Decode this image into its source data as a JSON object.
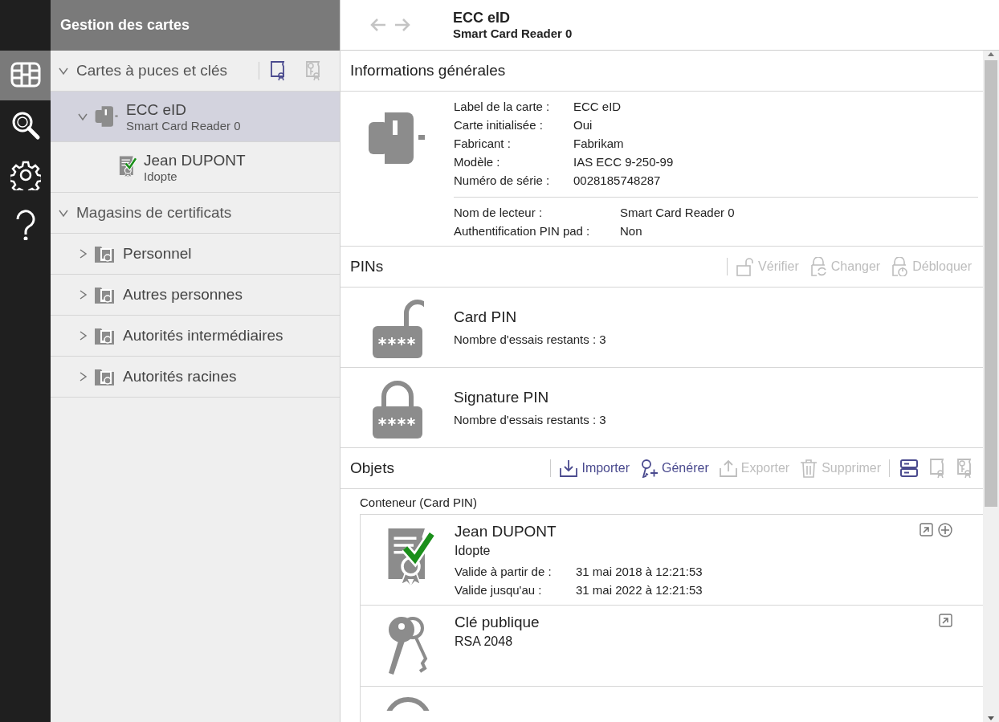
{
  "nav_rail": [
    {
      "kind": "cards",
      "selected": true
    },
    {
      "kind": "search",
      "selected": false
    },
    {
      "kind": "settings",
      "selected": false
    },
    {
      "kind": "help",
      "selected": false
    }
  ],
  "sidebar": {
    "title": "Gestion des cartes",
    "sections": [
      {
        "label": "Cartes à puces et clés",
        "expanded": true,
        "tools": [
          {
            "kind": "certificate",
            "disabled": false
          },
          {
            "kind": "key-certificate",
            "disabled": true
          }
        ],
        "children": [
          {
            "kind": "card",
            "title": "ECC eID",
            "subtitle": "Smart Card Reader 0",
            "selected": true,
            "expanded": true,
            "children": [
              {
                "kind": "certificate",
                "title": "Jean DUPONT",
                "subtitle": "Idopte",
                "selected": false
              }
            ]
          }
        ]
      },
      {
        "label": "Magasins de certificats",
        "expanded": true,
        "children": [
          {
            "kind": "store",
            "title": "Personnel",
            "selected": false,
            "expanded": false
          },
          {
            "kind": "store",
            "title": "Autres personnes",
            "selected": false,
            "expanded": false
          },
          {
            "kind": "store",
            "title": "Autorités intermédiaires",
            "selected": false,
            "expanded": false
          },
          {
            "kind": "store",
            "title": "Autorités racines",
            "selected": false,
            "expanded": false
          }
        ]
      }
    ]
  },
  "header": {
    "nav_buttons": [
      {
        "kind": "back",
        "disabled": true
      },
      {
        "kind": "forward",
        "disabled": true
      }
    ],
    "title": "ECC eID",
    "subtitle": "Smart Card Reader 0"
  },
  "general": {
    "title": "Informations générales",
    "card_fields": [
      {
        "label": "Label de la carte :",
        "value": "ECC eID"
      },
      {
        "label": "Carte initialisée :",
        "value": "Oui"
      },
      {
        "label": "Fabricant :",
        "value": "Fabrikam"
      },
      {
        "label": "Modèle :",
        "value": "IAS ECC 9-250-99"
      },
      {
        "label": "Numéro de série :",
        "value": "0028185748287"
      }
    ],
    "reader_fields": [
      {
        "label": "Nom de lecteur :",
        "value": "Smart Card Reader 0"
      },
      {
        "label": "Authentification PIN pad :",
        "value": "Non"
      }
    ]
  },
  "pins": {
    "title": "PINs",
    "actions": [
      {
        "kind": "verify",
        "label": "Vérifier",
        "disabled": true
      },
      {
        "kind": "change",
        "label": "Changer",
        "disabled": true
      },
      {
        "kind": "unblock",
        "label": "Débloquer",
        "disabled": true
      }
    ],
    "items": [
      {
        "kind": "unlocked",
        "name": "Card PIN",
        "info": "Nombre d'essais restants : 3"
      },
      {
        "kind": "locked",
        "name": "Signature PIN",
        "info": "Nombre d'essais restants : 3"
      }
    ]
  },
  "objects": {
    "title": "Objets",
    "actions": [
      {
        "kind": "import",
        "label": "Importer",
        "disabled": false
      },
      {
        "kind": "generate",
        "label": "Générer",
        "disabled": false
      },
      {
        "kind": "export",
        "label": "Exporter",
        "disabled": true
      },
      {
        "kind": "delete",
        "label": "Supprimer",
        "disabled": true
      }
    ],
    "view_tools": [
      {
        "kind": "list",
        "disabled": false
      },
      {
        "kind": "certificate",
        "disabled": true
      },
      {
        "kind": "key-certificate",
        "disabled": true
      }
    ],
    "container": "Conteneur (Card PIN)",
    "items": [
      {
        "kind": "certificate",
        "title": "Jean DUPONT",
        "subtitle": "Idopte",
        "fields": [
          {
            "label": "Valide à partir de :",
            "value": "31 mai 2018 à 12:21:53"
          },
          {
            "label": "Valide jusqu'au :",
            "value": "31 mai 2022 à 12:21:53"
          }
        ],
        "buttons": [
          {
            "kind": "open"
          },
          {
            "kind": "add"
          }
        ]
      },
      {
        "kind": "public-key",
        "title": "Clé publique",
        "subtitle": "RSA 2048",
        "buttons": [
          {
            "kind": "open"
          }
        ]
      },
      {
        "kind": "private-key"
      }
    ]
  }
}
